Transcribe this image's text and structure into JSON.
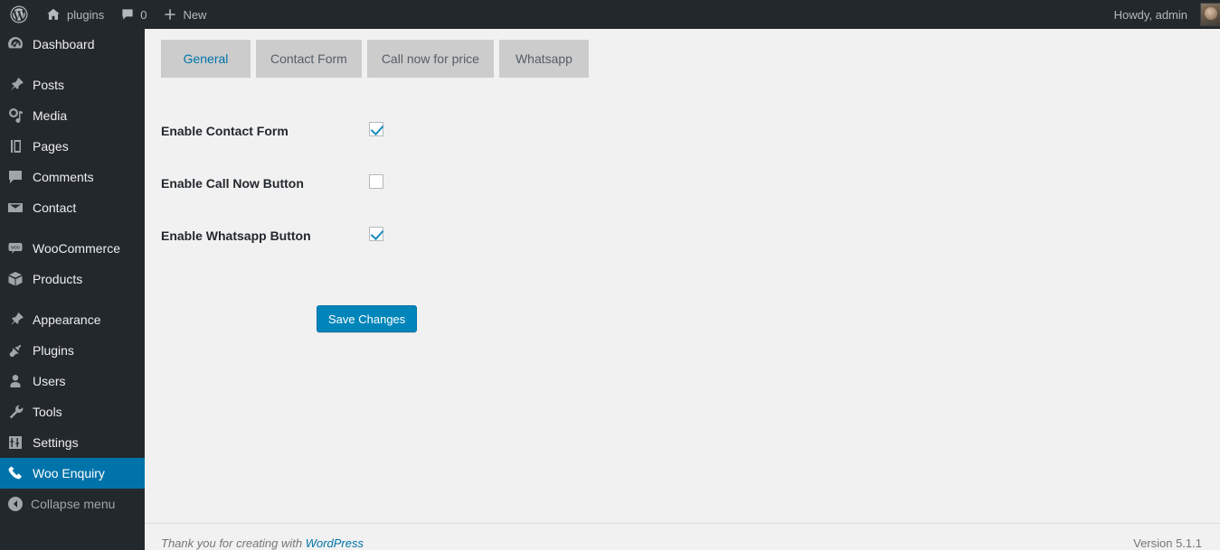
{
  "adminbar": {
    "logo_icon": "wordpress-logo-icon",
    "site_icon": "home-icon",
    "site_name": "plugins",
    "comments_icon": "comment-bubble-icon",
    "comments_count": "0",
    "new_icon": "plus-icon",
    "new_label": "New",
    "howdy": "Howdy, admin",
    "avatar": "user-avatar"
  },
  "sidebar": {
    "items": [
      {
        "label": "Dashboard",
        "icon": "dashboard-icon",
        "current": false,
        "sep_after": true
      },
      {
        "label": "Posts",
        "icon": "pin-icon",
        "current": false,
        "sep_after": false
      },
      {
        "label": "Media",
        "icon": "media-icon",
        "current": false,
        "sep_after": false
      },
      {
        "label": "Pages",
        "icon": "pages-icon",
        "current": false,
        "sep_after": false
      },
      {
        "label": "Comments",
        "icon": "comment-bubble-icon",
        "current": false,
        "sep_after": false
      },
      {
        "label": "Contact",
        "icon": "envelope-icon",
        "current": false,
        "sep_after": true
      },
      {
        "label": "WooCommerce",
        "icon": "woocommerce-icon",
        "current": false,
        "sep_after": false
      },
      {
        "label": "Products",
        "icon": "box-icon",
        "current": false,
        "sep_after": true
      },
      {
        "label": "Appearance",
        "icon": "paintbrush-icon",
        "current": false,
        "sep_after": false
      },
      {
        "label": "Plugins",
        "icon": "plug-icon",
        "current": false,
        "sep_after": false
      },
      {
        "label": "Users",
        "icon": "user-icon",
        "current": false,
        "sep_after": false
      },
      {
        "label": "Tools",
        "icon": "wrench-icon",
        "current": false,
        "sep_after": false
      },
      {
        "label": "Settings",
        "icon": "sliders-icon",
        "current": false,
        "sep_after": false
      },
      {
        "label": "Woo Enquiry",
        "icon": "phone-icon",
        "current": true,
        "sep_after": false
      }
    ],
    "collapse_label": "Collapse menu",
    "collapse_icon": "collapse-arrow-icon",
    "active_color": "#0073aa"
  },
  "tabs": [
    {
      "label": "General",
      "active": true
    },
    {
      "label": "Contact Form",
      "active": false
    },
    {
      "label": "Call now for price",
      "active": false
    },
    {
      "label": "Whatsapp",
      "active": false
    }
  ],
  "settings": {
    "rows": [
      {
        "label": "Enable Contact Form",
        "checked": true,
        "name": "enable-contact-form"
      },
      {
        "label": "Enable Call Now Button",
        "checked": false,
        "name": "enable-call-now-button"
      },
      {
        "label": "Enable Whatsapp Button",
        "checked": true,
        "name": "enable-whatsapp-button"
      }
    ],
    "save_label": "Save Changes",
    "save_color": "#0085ba"
  },
  "footer": {
    "thanks_prefix": "Thank you for creating with ",
    "thanks_link": "WordPress",
    "version": "Version 5.1.1"
  }
}
